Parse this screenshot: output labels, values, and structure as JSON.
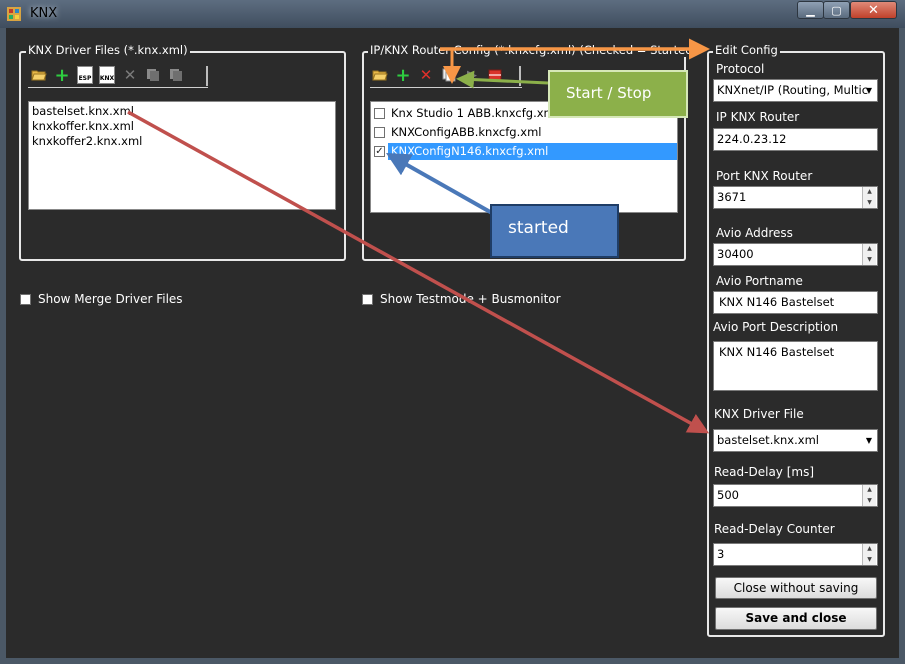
{
  "window": {
    "title": "KNX"
  },
  "title_controls": {
    "minimize": "▁",
    "maximize": "▢",
    "close": "✕"
  },
  "driver_files": {
    "legend": "KNX Driver Files (*.knx.xml)",
    "toolbar": {
      "esp_label": "ESP",
      "knx_label": "KNX"
    },
    "items": [
      "bastelset.knx.xml",
      "knxkoffer.knx.xml",
      "knxkoffer2.knx.xml"
    ],
    "show_merge_label": "Show Merge Driver Files"
  },
  "router_config": {
    "legend": "IP/KNX Router Config (*.knxcfg.xml) (Checked = Started)",
    "items": [
      {
        "label": "Knx Studio 1 ABB.knxcfg.xml",
        "checked": false,
        "selected": false
      },
      {
        "label": "KNXConfigABB.knxcfg.xml",
        "checked": false,
        "selected": false
      },
      {
        "label": "KNXConfigN146.knxcfg.xml",
        "checked": true,
        "selected": true
      }
    ],
    "show_testmode_label": "Show Testmode + Busmonitor"
  },
  "edit_config": {
    "legend": "Edit Config",
    "protocol_label": "Protocol",
    "protocol_value": "KNXnet/IP (Routing, Multic",
    "ip_label": "IP KNX Router",
    "ip_value": "224.0.23.12",
    "port_label": "Port KNX Router",
    "port_value": "3671",
    "avio_address_label": "Avio Address",
    "avio_address_value": "30400",
    "avio_portname_label": "Avio Portname",
    "avio_portname_value": "KNX N146 Bastelset",
    "avio_desc_label": "Avio Port Description",
    "avio_desc_value": "KNX N146 Bastelset",
    "driver_file_label": "KNX Driver File",
    "driver_file_value": "bastelset.knx.xml",
    "read_delay_label": "Read-Delay [ms]",
    "read_delay_value": "500",
    "read_delay_counter_label": "Read-Delay Counter",
    "read_delay_counter_value": "3",
    "close_without_saving": "Close without saving",
    "save_and_close": "Save and close"
  },
  "annotations": {
    "start_stop": "Start / Stop",
    "started": "started"
  },
  "colors": {
    "background": "#2b2b2b",
    "selection": "#3399ff",
    "callout_green": "#8cb04a",
    "callout_blue": "#4a78b8",
    "arrow_red": "#c0504d",
    "arrow_orange": "#f79646"
  }
}
